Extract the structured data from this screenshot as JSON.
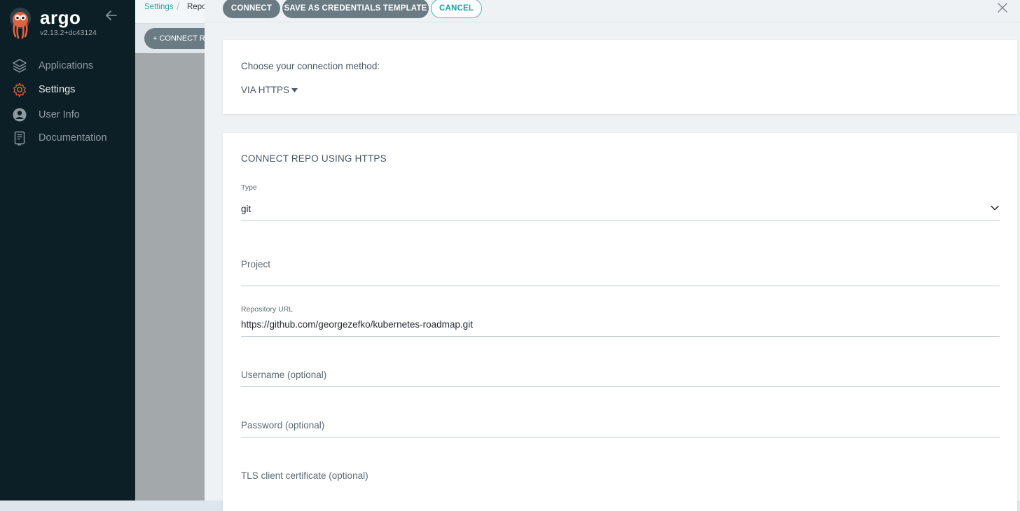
{
  "sidebar": {
    "logo_text": "argo",
    "version": "v2.13.2+dc43124",
    "items": [
      {
        "label": "Applications",
        "icon": "layers-icon"
      },
      {
        "label": "Settings",
        "icon": "gear-icon"
      },
      {
        "label": "User Info",
        "icon": "user-icon"
      },
      {
        "label": "Documentation",
        "icon": "book-icon"
      }
    ]
  },
  "background": {
    "breadcrumb": [
      "Settings",
      "Repo"
    ],
    "connect_repo_label": "+ CONNECT R"
  },
  "panel": {
    "buttons": {
      "connect": "CONNECT",
      "save_template": "SAVE AS CREDENTIALS TEMPLATE",
      "cancel": "CANCEL"
    },
    "method": {
      "label": "Choose your connection method:",
      "value": "VIA HTTPS"
    },
    "form": {
      "title": "CONNECT REPO USING HTTPS",
      "type": {
        "label": "Type",
        "value": "git"
      },
      "project": {
        "placeholder": "Project"
      },
      "repo_url": {
        "label": "Repository URL",
        "value": "https://github.com/georgezefko/kubernetes-roadmap.git"
      },
      "username": {
        "placeholder": "Username (optional)"
      },
      "password": {
        "placeholder": "Password (optional)"
      },
      "tls_cert": {
        "placeholder": "TLS client certificate (optional)"
      }
    }
  },
  "colors": {
    "sidebar_bg": "#0d1f26",
    "accent_teal": "#1aa3a3",
    "button_gray": "#6b7b84"
  }
}
